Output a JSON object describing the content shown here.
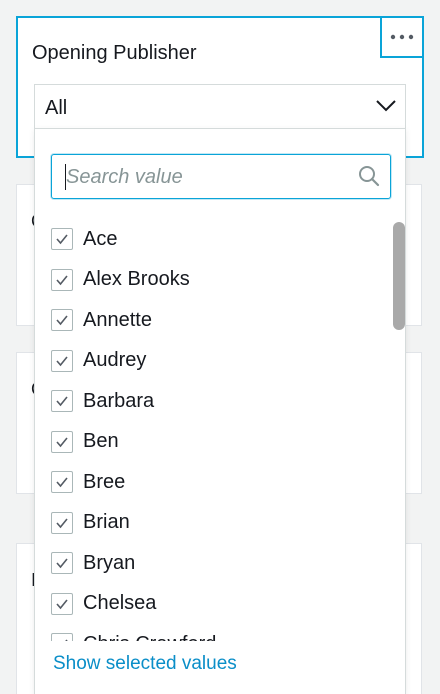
{
  "control": {
    "title": "Opening Publisher",
    "selected_value": "All"
  },
  "background_cards": [
    {
      "peek_text": "C"
    },
    {
      "peek_text": "C"
    },
    {
      "peek_text": "I"
    }
  ],
  "dropdown": {
    "search_placeholder": "Search value",
    "options": [
      {
        "label": "Ace",
        "checked": true
      },
      {
        "label": "Alex Brooks",
        "checked": true
      },
      {
        "label": "Annette",
        "checked": true
      },
      {
        "label": "Audrey",
        "checked": true
      },
      {
        "label": "Barbara",
        "checked": true
      },
      {
        "label": "Ben",
        "checked": true
      },
      {
        "label": "Bree",
        "checked": true
      },
      {
        "label": "Brian",
        "checked": true
      },
      {
        "label": "Bryan",
        "checked": true
      },
      {
        "label": "Chelsea",
        "checked": true
      },
      {
        "label": "Chris Crawford",
        "checked": true
      }
    ],
    "footer_link": "Show selected values"
  },
  "colors": {
    "accent": "#0aa4d8",
    "link": "#0a8ec8",
    "text": "#16191f"
  },
  "icons": {
    "more": "ellipsis-icon",
    "select": "chevron-down-icon",
    "search": "search-icon",
    "check": "check-icon"
  }
}
